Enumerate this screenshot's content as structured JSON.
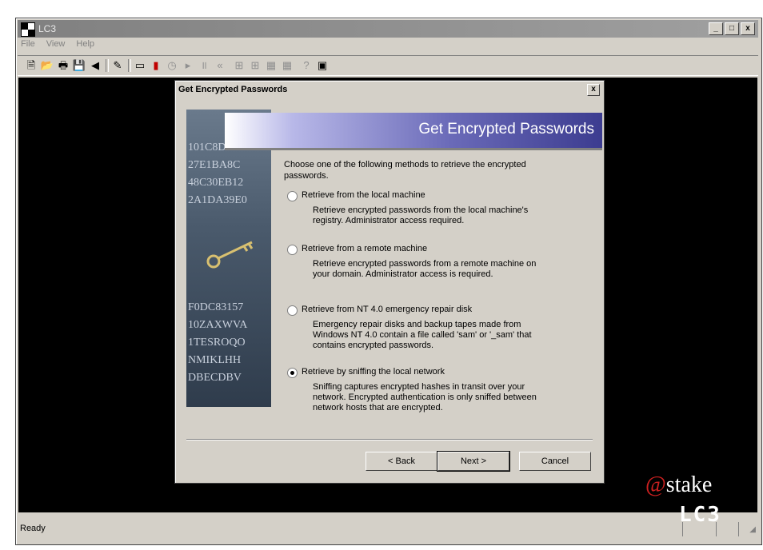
{
  "window": {
    "title": "LC3",
    "controls": [
      "_",
      "□",
      "x"
    ]
  },
  "menu": [
    {
      "label": "File"
    },
    {
      "label": "View"
    },
    {
      "label": "Help"
    }
  ],
  "status": {
    "text": "Ready"
  },
  "logo": {
    "stake_at": "@",
    "stake_text": "stake",
    "product": "LC3"
  },
  "dialog": {
    "title": "Get Encrypted Passwords",
    "close": "x",
    "banner_title": "Get Encrypted Passwords",
    "intro": "Choose one of the following methods to retrieve the encrypted passwords.",
    "side_text": [
      "101C8D...",
      "27E1BA8C",
      "48C30EB12",
      "2A1DA39E0",
      "F0DC83157",
      "10ZAXWVA",
      "1TESROQO",
      "NMIKLHH",
      "DBECDBV"
    ],
    "options": [
      {
        "label": "Retrieve from the local machine",
        "desc": "Retrieve encrypted passwords from the local machine's registry. Administrator access required.",
        "selected": false
      },
      {
        "label": "Retrieve from a remote machine",
        "desc": "Retrieve encrypted passwords from a remote machine on your domain. Administrator access is required.",
        "selected": false
      },
      {
        "label": "Retrieve from NT 4.0 emergency repair disk",
        "desc": "Emergency repair disks and backup tapes made from Windows NT 4.0 contain a file called 'sam' or '_sam' that contains encrypted passwords.",
        "selected": false
      },
      {
        "label": "Retrieve by sniffing the local network",
        "desc": "Sniffing captures encrypted hashes in transit over your network. Encrypted authentication is only sniffed between network hosts that are encrypted.",
        "selected": true
      }
    ],
    "buttons": {
      "back": "< Back",
      "next": "Next >",
      "cancel": "Cancel"
    }
  }
}
